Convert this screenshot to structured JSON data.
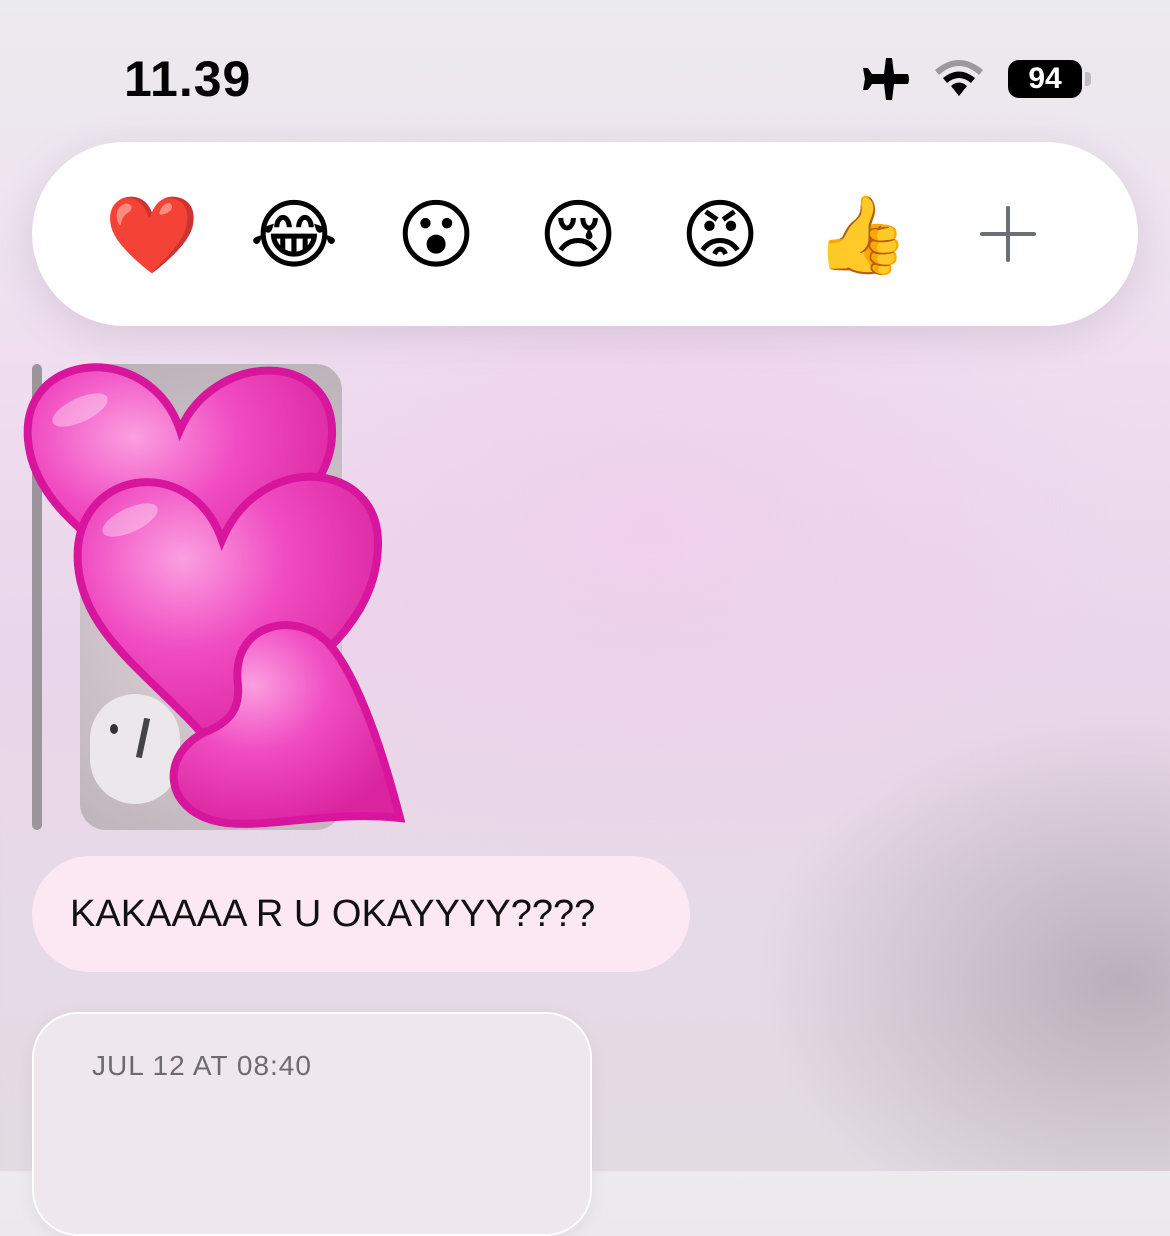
{
  "status_bar": {
    "time": "11.39",
    "battery_level": "94",
    "icons": [
      "airplane-icon",
      "wifi-icon",
      "battery-icon"
    ]
  },
  "reactions": {
    "items": [
      {
        "name": "heart",
        "glyph": "❤️"
      },
      {
        "name": "laughing",
        "glyph": "😂"
      },
      {
        "name": "surprised",
        "glyph": "😮"
      },
      {
        "name": "crying",
        "glyph": "😢"
      },
      {
        "name": "angry",
        "glyph": "😡"
      },
      {
        "name": "thumbs-up",
        "glyph": "👍"
      }
    ],
    "more_icon": "plus-icon"
  },
  "message": {
    "text": "KAKAAAA R U OKAYYYY????"
  },
  "card": {
    "date": "JUL 12 AT 08:40"
  },
  "colors": {
    "bubble": "#fbe8f2",
    "hearts": "#ee3cb5",
    "reaction_bar": "#ffffff"
  }
}
